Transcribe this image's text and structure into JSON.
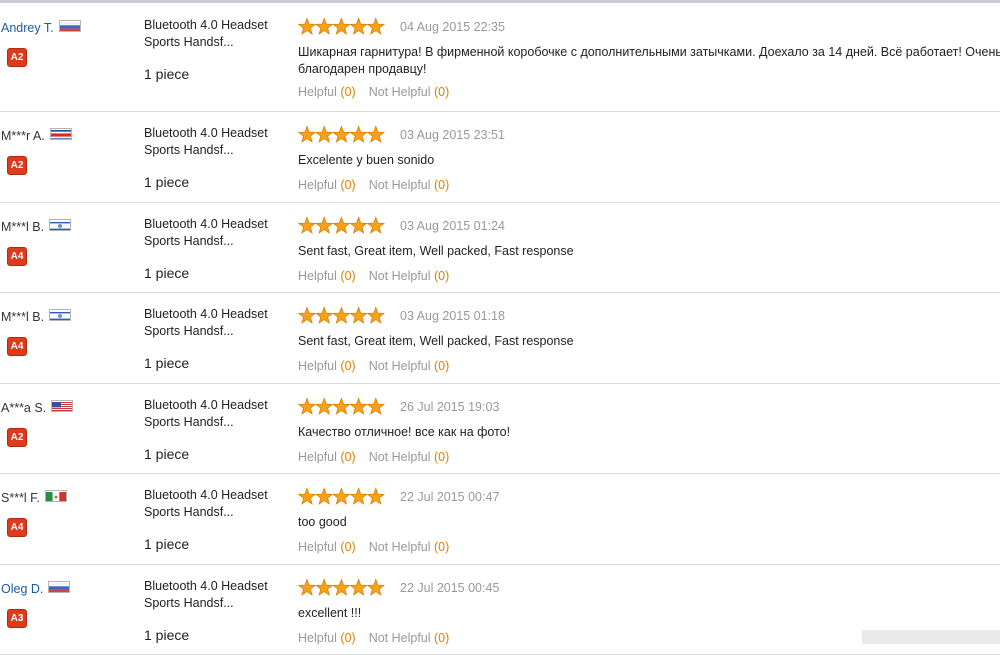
{
  "colors": {
    "badge_red": "#dd3b1e",
    "link_blue": "#1a5ca8",
    "count_orange": "#e28000",
    "star_orange": "#f6a21c"
  },
  "icons": {
    "rating": "star-icon",
    "buyer_level": "level-badge",
    "country": "country-flag-icon"
  },
  "reviews": [
    {
      "name": "Andrey T.",
      "name_link": true,
      "flag": "ru",
      "level": "A2",
      "product_line1": "Bluetooth 4.0 Headset",
      "product_line2": "Sports Handsf...",
      "quantity": "1 piece",
      "rating": 5,
      "date": "04 Aug 2015 22:35",
      "comment_line1": "Шикарная гарнитура! В фирменной коробочке с дополнительными затычками. Доехало за 14 дней. Всё работает! Очень",
      "comment_line2": "благодарен продавцу!",
      "helpful_label": "Helpful",
      "helpful_count": "(0)",
      "not_helpful_label": "Not Helpful",
      "not_helpful_count": "(0)"
    },
    {
      "name": "M***r A.",
      "name_link": false,
      "flag": "cr",
      "level": "A2",
      "product_line1": "Bluetooth 4.0 Headset",
      "product_line2": "Sports Handsf...",
      "quantity": "1 piece",
      "rating": 5,
      "date": "03 Aug 2015 23:51",
      "comment_line1": "Excelente y buen sonido",
      "comment_line2": "",
      "helpful_label": "Helpful",
      "helpful_count": "(0)",
      "not_helpful_label": "Not Helpful",
      "not_helpful_count": "(0)"
    },
    {
      "name": "M***l B.",
      "name_link": false,
      "flag": "il",
      "level": "A4",
      "product_line1": "Bluetooth 4.0 Headset",
      "product_line2": "Sports Handsf...",
      "quantity": "1 piece",
      "rating": 5,
      "date": "03 Aug 2015 01:24",
      "comment_line1": "Sent fast, Great item, Well packed, Fast response",
      "comment_line2": "",
      "helpful_label": "Helpful",
      "helpful_count": "(0)",
      "not_helpful_label": "Not Helpful",
      "not_helpful_count": "(0)"
    },
    {
      "name": "M***l B.",
      "name_link": false,
      "flag": "il",
      "level": "A4",
      "product_line1": "Bluetooth 4.0 Headset",
      "product_line2": "Sports Handsf...",
      "quantity": "1 piece",
      "rating": 5,
      "date": "03 Aug 2015 01:18",
      "comment_line1": "Sent fast, Great item, Well packed, Fast response",
      "comment_line2": "",
      "helpful_label": "Helpful",
      "helpful_count": "(0)",
      "not_helpful_label": "Not Helpful",
      "not_helpful_count": "(0)"
    },
    {
      "name": "A***a S.",
      "name_link": false,
      "flag": "us",
      "level": "A2",
      "product_line1": "Bluetooth 4.0 Headset",
      "product_line2": "Sports Handsf...",
      "quantity": "1 piece",
      "rating": 5,
      "date": "26 Jul 2015 19:03",
      "comment_line1": "Качество отличное! все как на фото!",
      "comment_line2": "",
      "helpful_label": "Helpful",
      "helpful_count": "(0)",
      "not_helpful_label": "Not Helpful",
      "not_helpful_count": "(0)"
    },
    {
      "name": "S***l F.",
      "name_link": false,
      "flag": "mx",
      "level": "A4",
      "product_line1": "Bluetooth 4.0 Headset",
      "product_line2": "Sports Handsf...",
      "quantity": "1 piece",
      "rating": 5,
      "date": "22 Jul 2015 00:47",
      "comment_line1": "too good",
      "comment_line2": "",
      "helpful_label": "Helpful",
      "helpful_count": "(0)",
      "not_helpful_label": "Not Helpful",
      "not_helpful_count": "(0)"
    },
    {
      "name": "Oleg D.",
      "name_link": true,
      "flag": "ru",
      "level": "A3",
      "product_line1": "Bluetooth 4.0 Headset",
      "product_line2": "Sports Handsf...",
      "quantity": "1 piece",
      "rating": 5,
      "date": "22 Jul 2015 00:45",
      "comment_line1": "excellent !!!",
      "comment_line2": "",
      "helpful_label": "Helpful",
      "helpful_count": "(0)",
      "not_helpful_label": "Not Helpful",
      "not_helpful_count": "(0)"
    }
  ]
}
